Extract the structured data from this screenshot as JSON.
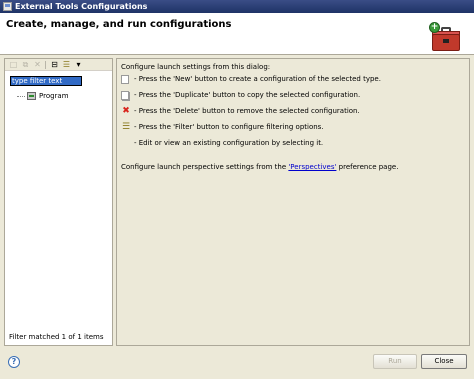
{
  "window": {
    "title": "External Tools Configurations"
  },
  "header": {
    "heading": "Create, manage, and run configurations"
  },
  "left": {
    "toolbar_icons": [
      "new-config-icon",
      "duplicate-icon",
      "delete-icon",
      "collapse-all-icon",
      "filter-icon",
      "dropdown-arrow-icon"
    ],
    "filter_text": "type filter text",
    "tree": [
      {
        "label": "Program"
      }
    ],
    "status": "Filter matched 1 of 1 items"
  },
  "right": {
    "intro": "Configure launch settings from this dialog:",
    "instructions": [
      {
        "icon": "new-config-icon",
        "text": "- Press the 'New' button to create a configuration of the selected type."
      },
      {
        "icon": "duplicate-icon",
        "text": "- Press the 'Duplicate' button to copy the selected configuration."
      },
      {
        "icon": "delete-icon",
        "text": "- Press the 'Delete' button to remove the selected configuration."
      },
      {
        "icon": "filter-icon",
        "text": "- Press the 'Filter' button to configure filtering options."
      },
      {
        "icon": "",
        "text": "- Edit or view an existing configuration by selecting it."
      }
    ],
    "perspectives_prefix": "Configure launch perspective settings from the ",
    "perspectives_link": "'Perspectives'",
    "perspectives_suffix": " preference page."
  },
  "buttons": {
    "help": "?",
    "run": "Run",
    "close": "Close"
  }
}
